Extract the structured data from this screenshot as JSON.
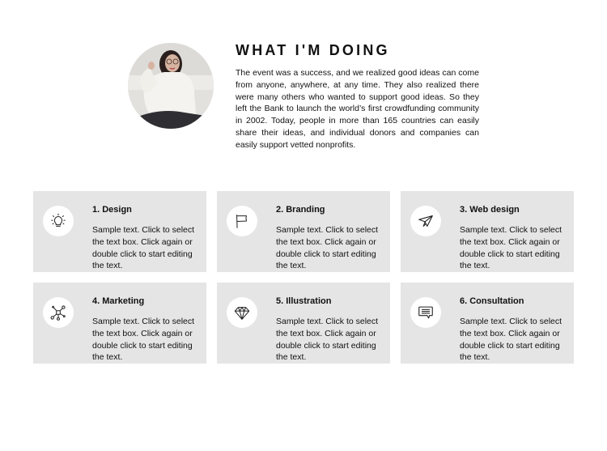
{
  "header": {
    "title": "WHAT I'M DOING",
    "intro": "The event was a success, and we realized good ideas can come from anyone, anywhere, at any time. They also realized there were many others who wanted to support good ideas. So they left the Bank to launch the world’s first crowdfunding community in 2002. Today, people in more than 165 countries can easily share their ideas, and individual donors and companies can easily support vetted nonprofits.",
    "avatar_alt": "Woman in white sweater with glasses"
  },
  "colors": {
    "card_background": "#e5e5e5",
    "icon_background": "#ffffff",
    "text": "#111111"
  },
  "services": [
    {
      "title": "1. Design",
      "icon": "lightbulb-icon",
      "text": "Sample text. Click to select the text box. Click again or double click to start editing the text."
    },
    {
      "title": "2. Branding",
      "icon": "flag-icon",
      "text": "Sample text. Click to select the text box. Click again or double click to start editing the text."
    },
    {
      "title": "3. Web design",
      "icon": "paper-plane-icon",
      "text": "Sample text. Click to select the text box. Click again or double click to start editing the text."
    },
    {
      "title": "4. Marketing",
      "icon": "network-icon",
      "text": "Sample text. Click to select the text box. Click again or double click to start editing the text."
    },
    {
      "title": "5. Illustration",
      "icon": "diamond-icon",
      "text": "Sample text. Click to select the text box. Click again or double click to start editing the text."
    },
    {
      "title": "6. Consultation",
      "icon": "chat-bubble-icon",
      "text": "Sample text. Click to select the text box. Click again or double click to start editing the text."
    }
  ]
}
